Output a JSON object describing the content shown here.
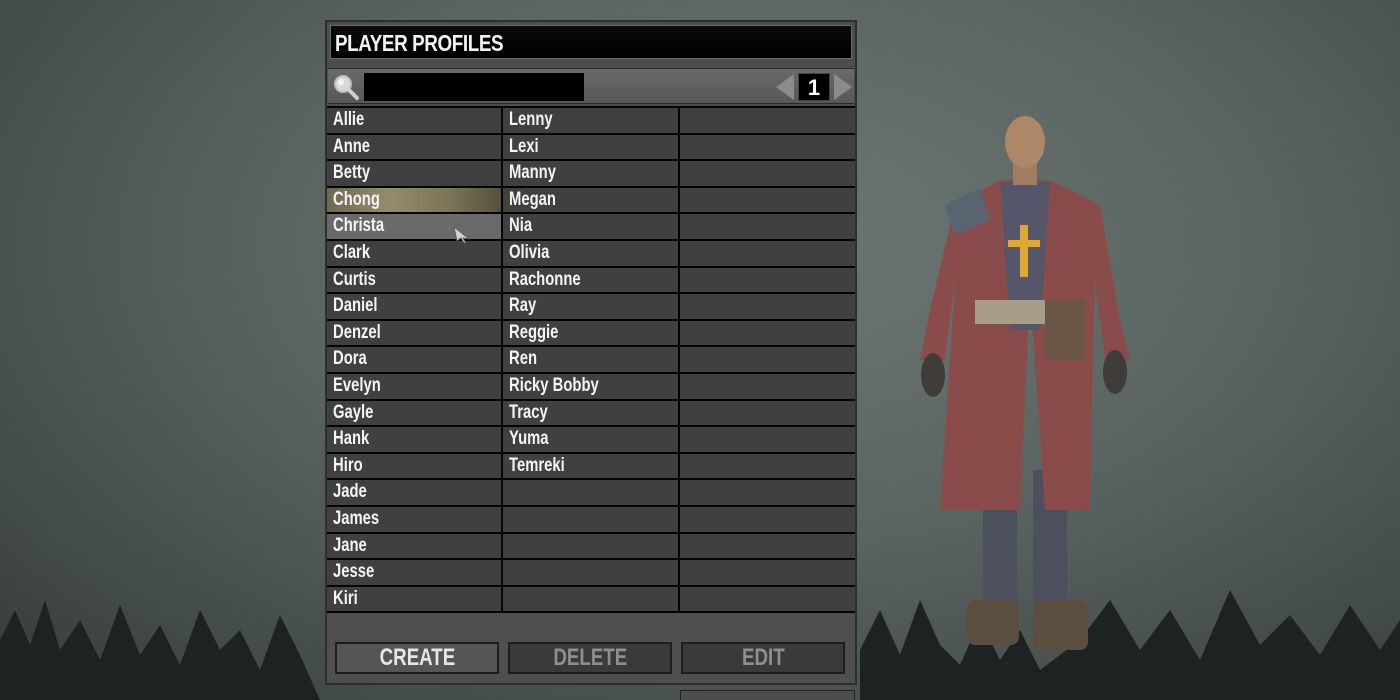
{
  "panel": {
    "title": "PLAYER PROFILES",
    "search": {
      "value": "",
      "placeholder": ""
    },
    "pager": {
      "page": "1",
      "prev_icon": "arrow-left-icon",
      "next_icon": "arrow-right-icon"
    },
    "columns": [
      [
        "Allie",
        "Anne",
        "Betty",
        "Chong",
        "Christa",
        "Clark",
        "Curtis",
        "Daniel",
        "Denzel",
        "Dora",
        "Evelyn",
        "Gayle",
        "Hank",
        "Hiro",
        "Jade",
        "James",
        "Jane",
        "Jesse",
        "Kiri"
      ],
      [
        "Lenny",
        "Lexi",
        "Manny",
        "Megan",
        "Nia",
        "Olivia",
        "Rachonne",
        "Ray",
        "Reggie",
        "Ren",
        "Ricky Bobby",
        "Tracy",
        "Yuma",
        "Temreki"
      ],
      []
    ],
    "rows_per_column": 19,
    "selected": "Chong",
    "hovered": "Christa",
    "buttons": {
      "create": "CREATE",
      "delete": "DELETE",
      "edit": "EDIT"
    }
  },
  "colors": {
    "selected_row": "#948c6e",
    "cell_bg": "#404040",
    "panel_bg": "#4d4d4d"
  }
}
